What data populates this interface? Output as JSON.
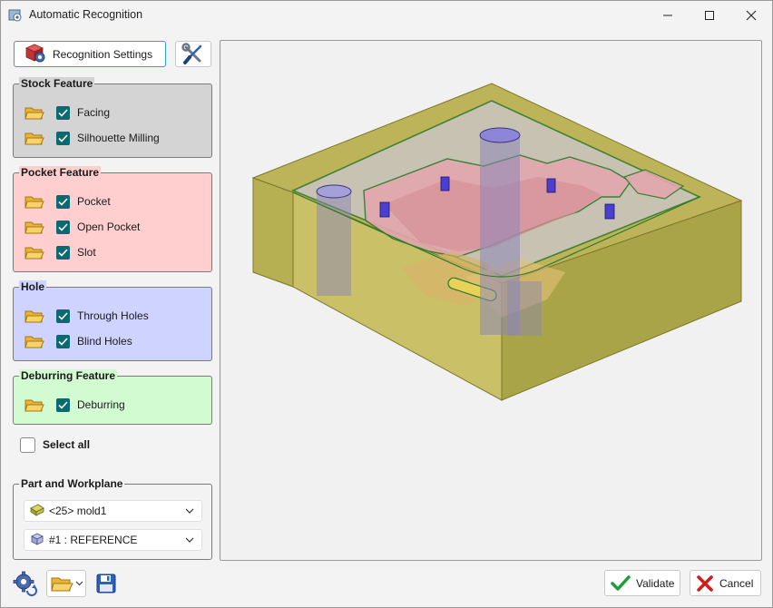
{
  "window": {
    "title": "Automatic Recognition",
    "controls": [
      "minimize",
      "maximize",
      "close"
    ]
  },
  "toolbar": {
    "settings_label": "Recognition Settings",
    "tools_icon": "wrench-screwdriver-icon"
  },
  "groups": {
    "stock": {
      "title": "Stock Feature",
      "color": "#d4d4d4",
      "items": [
        {
          "label": "Facing",
          "checked": true
        },
        {
          "label": "Silhouette Milling",
          "checked": true
        }
      ]
    },
    "pocket": {
      "title": "Pocket Feature",
      "color": "#ffcfcf",
      "items": [
        {
          "label": "Pocket",
          "checked": true
        },
        {
          "label": "Open Pocket",
          "checked": true
        },
        {
          "label": "Slot",
          "checked": true
        }
      ]
    },
    "hole": {
      "title": "Hole",
      "color": "#cfd3ff",
      "items": [
        {
          "label": "Through Holes",
          "checked": true
        },
        {
          "label": "Blind Holes",
          "checked": true
        }
      ]
    },
    "deburring": {
      "title": "Deburring Feature",
      "color": "#d2fbd2",
      "items": [
        {
          "label": "Deburring",
          "checked": true
        }
      ]
    }
  },
  "select_all": {
    "label": "Select all",
    "checked": false
  },
  "part_workplane": {
    "title": "Part and Workplane",
    "part": "<25> mold1",
    "workplane": "#1 : REFERENCE"
  },
  "footer": {
    "validate_label": "Validate",
    "cancel_label": "Cancel",
    "validate_color": "#1e9e3a",
    "cancel_color": "#d11a1a"
  }
}
